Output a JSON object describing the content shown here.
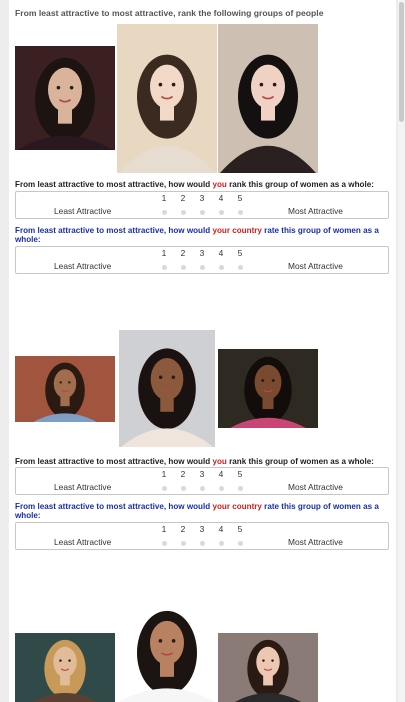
{
  "survey": {
    "intro": "From least attractive to most attractive, rank the following groups of people",
    "question_self": {
      "pre": "From least attractive to most attractive, how would ",
      "em": "you",
      "post": " rank this group of women as a whole:"
    },
    "question_country": {
      "pre": "From least attractive to most attractive, how would ",
      "em": "your country",
      "post": " rate this group of women as a whole:"
    },
    "scale": {
      "low_label": "Least Attractive",
      "high_label": "Most Attractive",
      "options": [
        "1",
        "2",
        "3",
        "4",
        "5"
      ]
    }
  },
  "groups": [
    {
      "photos": [
        {
          "name": "photo-woman-1",
          "bg": "#3a2020",
          "skin": "#d9b49a",
          "hair": "#1d1412",
          "cloth": "#2a1820"
        },
        {
          "name": "photo-woman-2",
          "bg": "#e8d8c2",
          "skin": "#f2d8c6",
          "hair": "#3a2a20",
          "cloth": "#e6dcd0"
        },
        {
          "name": "photo-woman-3",
          "bg": "#cdbfb1",
          "skin": "#f0d2c4",
          "hair": "#141010",
          "cloth": "#2b2020"
        }
      ]
    },
    {
      "photos": [
        {
          "name": "photo-woman-4",
          "bg": "#a2553e",
          "skin": "#a26d4c",
          "hair": "#2a1a12",
          "cloth": "#7f9ec4"
        },
        {
          "name": "photo-woman-5",
          "bg": "#cfd0d4",
          "skin": "#8b5a3c",
          "hair": "#1a1210",
          "cloth": "#efe5dc"
        },
        {
          "name": "photo-woman-6",
          "bg": "#2e2a22",
          "skin": "#7a4a30",
          "hair": "#120c0a",
          "cloth": "#c94574"
        }
      ]
    },
    {
      "photos": [
        {
          "name": "photo-woman-7",
          "bg": "#2f4a48",
          "skin": "#e2bc98",
          "hair": "#c79a5a",
          "cloth": "#5a4030"
        },
        {
          "name": "photo-woman-8",
          "bg": "#ffffff",
          "skin": "#b88262",
          "hair": "#1c1410",
          "cloth": "#f6f6f6"
        },
        {
          "name": "photo-woman-9",
          "bg": "#8a7b76",
          "skin": "#ecc8b2",
          "hair": "#2a1a14",
          "cloth": "#2a2a2a"
        }
      ]
    }
  ]
}
